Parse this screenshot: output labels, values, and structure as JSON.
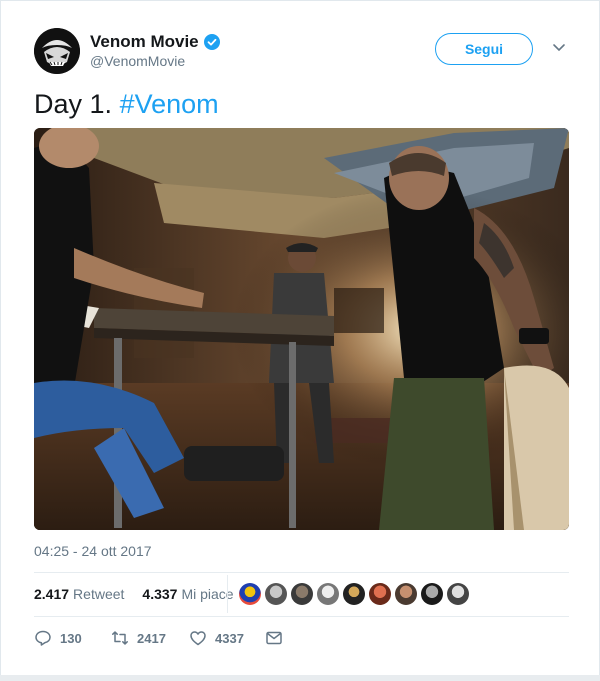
{
  "tweet": {
    "author": {
      "display_name": "Venom Movie",
      "handle": "@VenomMovie",
      "verified_icon": "verified-badge-icon",
      "avatar_icon": "venom-avatar"
    },
    "follow_label": "Segui",
    "text_prefix": "Day 1.",
    "hashtag": "#Venom",
    "image_alt": "movie set photo",
    "timestamp": "04:25 - 24 ott 2017",
    "stats": {
      "retweets_count": "2.417",
      "retweets_label": "Retweet",
      "likes_count": "4.337",
      "likes_label": "Mi piace"
    },
    "likers_count": 10,
    "actions": {
      "reply_count": "130",
      "retweet_count": "2417",
      "like_count": "4337"
    }
  },
  "colors": {
    "accent": "#1da1f2",
    "secondary_text": "#657786",
    "primary_text": "#14171a",
    "border": "#e6ecf0"
  }
}
